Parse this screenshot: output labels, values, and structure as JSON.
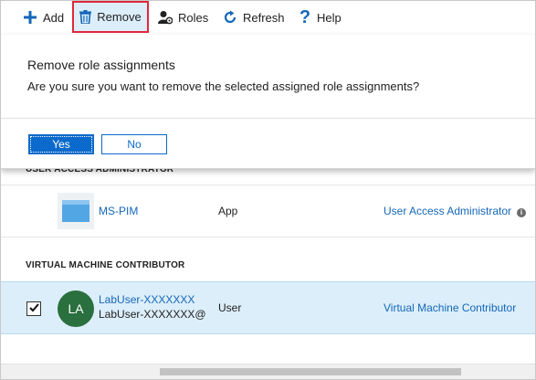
{
  "toolbar": {
    "add_label": "Add",
    "remove_label": "Remove",
    "roles_label": "Roles",
    "refresh_label": "Refresh",
    "help_label": "Help"
  },
  "colors": {
    "accent": "#0b6acb",
    "highlight": "#e0283c",
    "selected_row": "#dceefa",
    "avatar": "#2a6f3e"
  },
  "dialog": {
    "title": "Remove role assignments",
    "message": "Are you sure you want to remove the selected assigned role assignments?",
    "yes_label": "Yes",
    "no_label": "No"
  },
  "sections": [
    {
      "heading": "USER ACCESS ADMINISTRATOR",
      "rows": [
        {
          "name": "MS-PIM",
          "type": "App",
          "role": "User Access Administrator",
          "icon": "app-icon"
        }
      ]
    },
    {
      "heading": "VIRTUAL MACHINE CONTRIBUTOR",
      "rows": [
        {
          "initials": "LA",
          "name": "LabUser-XXXXXXX",
          "email": "LabUser-XXXXXXX@",
          "type": "User",
          "role": "Virtual Machine Contributor",
          "checked": true
        }
      ]
    }
  ]
}
